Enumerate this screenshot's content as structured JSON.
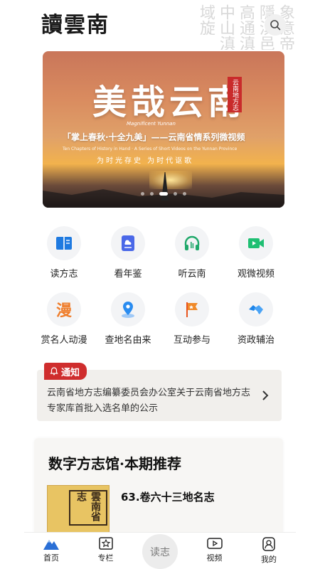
{
  "app": {
    "logo_text": "讀雲南",
    "bg_calligraphy": "象意帝定隱滇邑范高通滇戰中山滇迷域旋"
  },
  "search": {
    "icon": "search-icon"
  },
  "banner": {
    "title": "美哉云南",
    "seal": "云南地方志",
    "english_title": "Magnificent Yunnan",
    "subtitle": "「掌上春秋·十全九美」——云南省情系列微视频",
    "english_subtitle": "Ten Chapters of History in Hand · A Series of Short Videos on the Yunnan Province",
    "slogan": "为时光存史  为时代讴歌",
    "dots": 5,
    "active_dot": 2
  },
  "grid": {
    "rows": [
      [
        {
          "label": "读方志",
          "icon": "book-icon",
          "color": "#1f7ae0"
        },
        {
          "label": "看年鉴",
          "icon": "yearbook-icon",
          "color": "#4a68e8"
        },
        {
          "label": "听云南",
          "icon": "headphones-icon",
          "color": "#1fa86a"
        },
        {
          "label": "观微视频",
          "icon": "video-icon",
          "color": "#1fbf73"
        }
      ],
      [
        {
          "label": "赏名人动漫",
          "icon": "comic-icon",
          "color": "#ef7d2b"
        },
        {
          "label": "查地名由来",
          "icon": "location-icon",
          "color": "#2a8cf0"
        },
        {
          "label": "互动参与",
          "icon": "flag-icon",
          "color": "#e8541e"
        },
        {
          "label": "资政辅治",
          "icon": "handshake-icon",
          "color": "#1e86ea"
        }
      ]
    ]
  },
  "notice": {
    "tag": "通知",
    "text": "云南省地方志编纂委员会办公室关于云南省地方志专家库首批入选名单的公示"
  },
  "recommend": {
    "title": "数字方志馆·本期推荐",
    "book_cover_text": "雲南省志",
    "item_title": "63.卷六十三地名志"
  },
  "tabbar": {
    "items": [
      {
        "label": "首页",
        "icon": "home-icon",
        "active": true
      },
      {
        "label": "专栏",
        "icon": "column-icon"
      },
      {
        "label": "读志",
        "icon": "read-center-icon"
      },
      {
        "label": "视频",
        "icon": "video-tab-icon"
      },
      {
        "label": "我的",
        "icon": "profile-icon"
      }
    ]
  },
  "colors": {
    "accent_red": "#cf2d2d",
    "notice_bg": "#f1efec",
    "icon_bg": "#f3f4f6"
  }
}
